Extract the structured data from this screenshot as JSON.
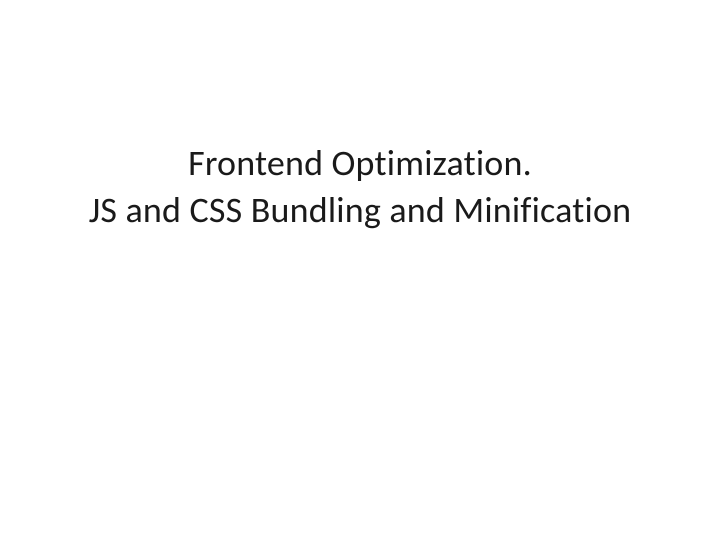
{
  "slide": {
    "title_line1": "Frontend Optimization.",
    "title_line2": "JS and CSS Bundling and Minification"
  }
}
